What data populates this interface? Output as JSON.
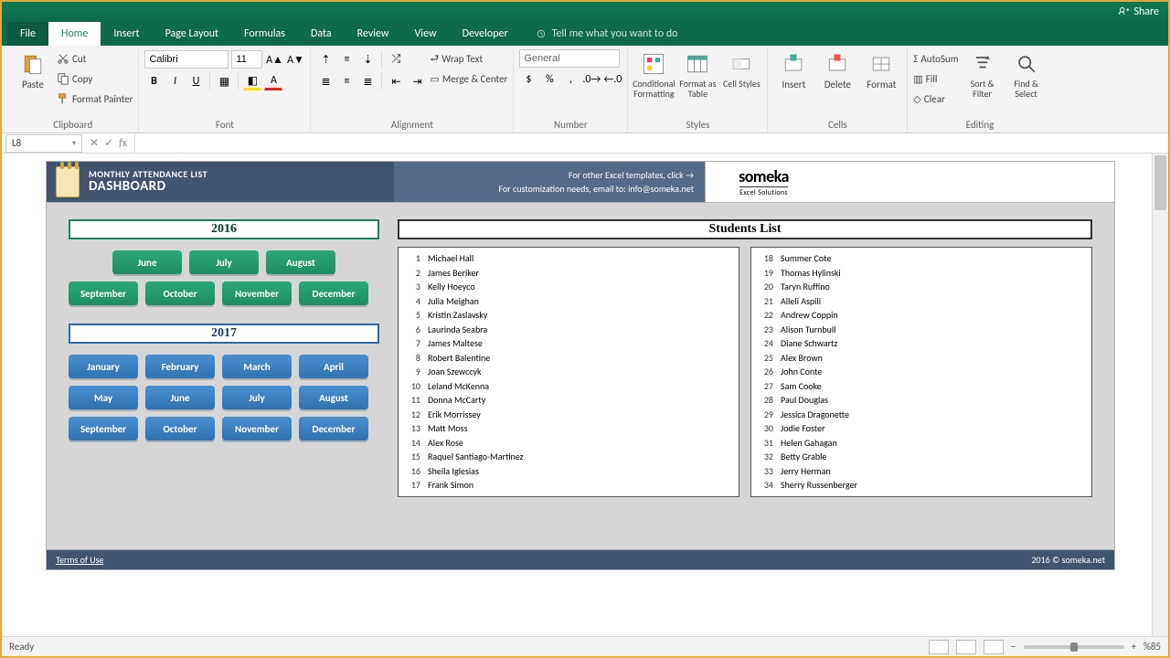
{
  "titlebar": {
    "share": "Share"
  },
  "menu": {
    "file": "File",
    "tabs": [
      "Home",
      "Insert",
      "Page Layout",
      "Formulas",
      "Data",
      "Review",
      "View",
      "Developer"
    ],
    "tellme": "Tell me what you want to do"
  },
  "ribbon": {
    "clipboard": {
      "paste": "Paste",
      "cut": "Cut",
      "copy": "Copy",
      "fmtpainter": "Format Painter",
      "label": "Clipboard"
    },
    "font": {
      "name": "Calibri",
      "size": "11",
      "label": "Font"
    },
    "alignment": {
      "wrap": "Wrap Text",
      "merge": "Merge & Center",
      "label": "Alignment"
    },
    "number": {
      "format": "General",
      "label": "Number"
    },
    "styles": {
      "cond": "Conditional Formatting",
      "fmtas": "Format as Table",
      "cell": "Cell Styles",
      "label": "Styles"
    },
    "cells": {
      "insert": "Insert",
      "delete": "Delete",
      "format": "Format",
      "label": "Cells"
    },
    "editing": {
      "autosum": "AutoSum",
      "fill": "Fill",
      "clear": "Clear",
      "sort": "Sort & Filter",
      "find": "Find & Select",
      "label": "Editing"
    }
  },
  "namebox": "L8",
  "dashboard": {
    "subtitle": "MONTHLY ATTENDANCE LIST",
    "title": "DASHBOARD",
    "info_line1": "For other Excel templates, click →",
    "info_line2": "For customization needs, email to: info@someka.net",
    "brand": "someka",
    "tagline": "Excel Solutions",
    "years": {
      "y2016": {
        "label": "2016",
        "months": [
          "June",
          "July",
          "August",
          "September",
          "October",
          "November",
          "December"
        ]
      },
      "y2017": {
        "label": "2017",
        "months": [
          "January",
          "February",
          "March",
          "April",
          "May",
          "June",
          "July",
          "August",
          "September",
          "October",
          "November",
          "December"
        ]
      }
    },
    "students_title": "Students List",
    "students": [
      {
        "n": 1,
        "name": "Michael Hall"
      },
      {
        "n": 2,
        "name": "James Beriker"
      },
      {
        "n": 3,
        "name": "Kelly Hoeyco"
      },
      {
        "n": 4,
        "name": "Julia Meighan"
      },
      {
        "n": 5,
        "name": "Kristin Zaslavsky"
      },
      {
        "n": 6,
        "name": "Laurinda Seabra"
      },
      {
        "n": 7,
        "name": "James Maltese"
      },
      {
        "n": 8,
        "name": "Robert Balentine"
      },
      {
        "n": 9,
        "name": "Joan Szewccyk"
      },
      {
        "n": 10,
        "name": "Leland McKenna"
      },
      {
        "n": 11,
        "name": "Donna McCarty"
      },
      {
        "n": 12,
        "name": "Erik Morrissey"
      },
      {
        "n": 13,
        "name": "Matt Moss"
      },
      {
        "n": 14,
        "name": "Alex Rose"
      },
      {
        "n": 15,
        "name": "Raquel Santiago-Martinez"
      },
      {
        "n": 16,
        "name": "Sheila Iglesias"
      },
      {
        "n": 17,
        "name": "Frank Simon"
      },
      {
        "n": 18,
        "name": "Summer Cote"
      },
      {
        "n": 19,
        "name": "Thomas Hylinski"
      },
      {
        "n": 20,
        "name": "Taryn Ruffino"
      },
      {
        "n": 21,
        "name": "Alleli Aspili"
      },
      {
        "n": 22,
        "name": "Andrew Coppin"
      },
      {
        "n": 23,
        "name": "Alison Turnbull"
      },
      {
        "n": 24,
        "name": "Diane Schwartz"
      },
      {
        "n": 25,
        "name": "Alex Brown"
      },
      {
        "n": 26,
        "name": "John Conte"
      },
      {
        "n": 27,
        "name": "Sam Cooke"
      },
      {
        "n": 28,
        "name": "Paul Douglas"
      },
      {
        "n": 29,
        "name": "Jessica Dragonette"
      },
      {
        "n": 30,
        "name": "Jodie Foster"
      },
      {
        "n": 31,
        "name": "Helen Gahagan"
      },
      {
        "n": 32,
        "name": "Betty Grable"
      },
      {
        "n": 33,
        "name": "Jerry Herman"
      },
      {
        "n": 34,
        "name": "Sherry Russenberger"
      }
    ],
    "footer_left": "Terms of Use",
    "footer_right": "2016 © someka.net"
  },
  "statusbar": {
    "ready": "Ready",
    "zoom": "%85"
  }
}
